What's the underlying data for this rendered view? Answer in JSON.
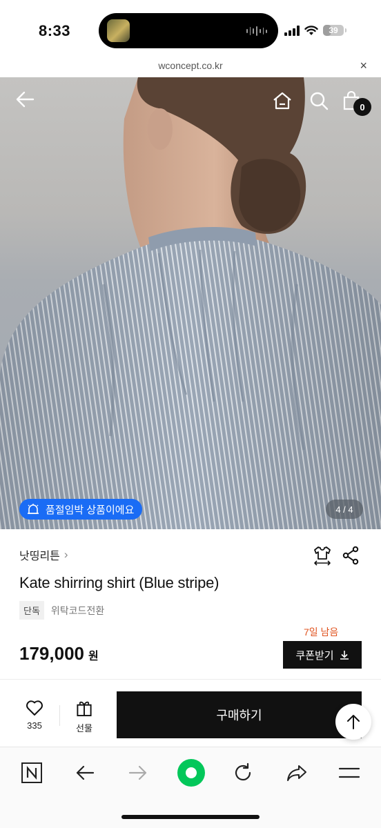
{
  "status_bar": {
    "time": "8:33",
    "battery": "39",
    "battery_level": 0.39
  },
  "url_bar": {
    "domain": "wconcept.co.kr",
    "close_label": "×"
  },
  "hero": {
    "cart_count": "0",
    "soldout_label": "품절임박 상품이에요",
    "image_counter": "4 / 4",
    "icons": [
      "back-arrow-icon",
      "home-icon",
      "search-icon",
      "shopping-bag-icon"
    ]
  },
  "product": {
    "brand": "낫띵리튼",
    "brand_chevron": "›",
    "name": "Kate shirring shirt (Blue stripe)",
    "tag_exclusive": "단독",
    "tag_code": "위탁코드전환",
    "days_left": "7일 남음",
    "price": "179,000",
    "price_unit": "원",
    "coupon_label": "쿠폰받기"
  },
  "purchase_bar": {
    "like_count": "335",
    "gift_label": "선물",
    "buy_label": "구매하기"
  },
  "colors": {
    "accent_blue": "#1a6cf5",
    "days_left_orange": "#e0531f",
    "naver_green": "#03c75a",
    "primary_black": "#111111"
  }
}
